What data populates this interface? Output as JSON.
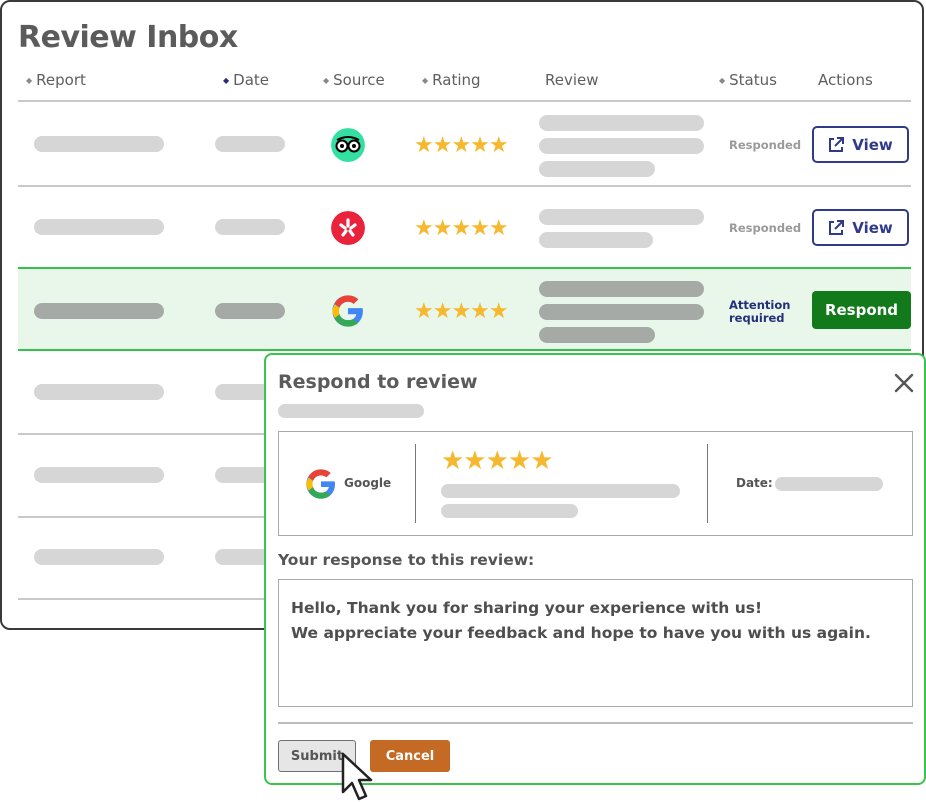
{
  "inbox": {
    "title": "Review Inbox",
    "columns": {
      "report": "Report",
      "date": "Date",
      "source": "Source",
      "rating": "Rating",
      "review": "Review",
      "status": "Status",
      "actions": "Actions"
    },
    "rows": [
      {
        "source": "tripadvisor-icon",
        "rating": "★★★★★",
        "status": "Responded",
        "action": "View"
      },
      {
        "source": "yelp-icon",
        "rating": "★★★★★",
        "status": "Responded",
        "action": "View"
      },
      {
        "source": "google-icon",
        "rating": "★★★★★",
        "status": "Attention required",
        "action": "Respond"
      },
      {},
      {},
      {}
    ]
  },
  "modal": {
    "title": "Respond to review",
    "source_name": "Google",
    "rating": "★★★★★",
    "date_label": "Date:",
    "response_label": "Your response to this review:",
    "response_text": "Hello, Thank you for sharing your experience with us!\nWe appreciate your feedback and hope to have you with us again.",
    "submit_label": "Submit",
    "cancel_label": "Cancel"
  },
  "colors": {
    "accent_green": "#127a1a",
    "highlight_green": "#35c24a",
    "star": "#f5b82e",
    "view_blue": "#2f3a88",
    "cancel_orange": "#c56a24"
  }
}
